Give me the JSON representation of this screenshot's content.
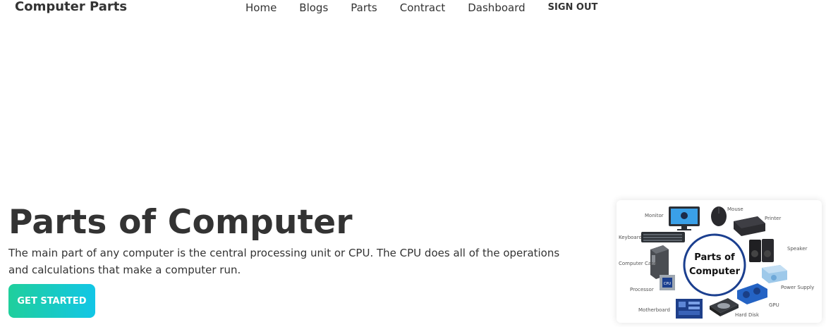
{
  "navbar": {
    "brand": "Computer Parts",
    "links": [
      {
        "label": "Home"
      },
      {
        "label": "Blogs"
      },
      {
        "label": "Parts"
      },
      {
        "label": "Contract"
      },
      {
        "label": "Dashboard"
      },
      {
        "label": "SIGN OUT"
      }
    ]
  },
  "hero": {
    "title": "Parts of Computer",
    "description": "The main part of any computer is the central processing unit or CPU. The CPU does all of the operations and calculations that make a computer run.",
    "cta_label": "GET STARTED"
  },
  "illustration": {
    "center_line1": "Parts of",
    "center_line2": "Computer",
    "labels": {
      "monitor": "Monitor",
      "mouse": "Mouse",
      "printer": "Printer",
      "keyboard": "Keyboard",
      "speaker": "Speaker",
      "computer_case": "Computer Case",
      "power_supply": "Power Supply",
      "processor": "Processor",
      "cpu_chip": "CPU",
      "gpu": "GPU",
      "motherboard": "Motherboard",
      "hard_disk": "Hard Disk"
    }
  },
  "colors": {
    "text": "#333333",
    "cta_gradient_start": "#1fcf9c",
    "cta_gradient_end": "#12c6e6",
    "circle_border": "#1b3f8f"
  }
}
